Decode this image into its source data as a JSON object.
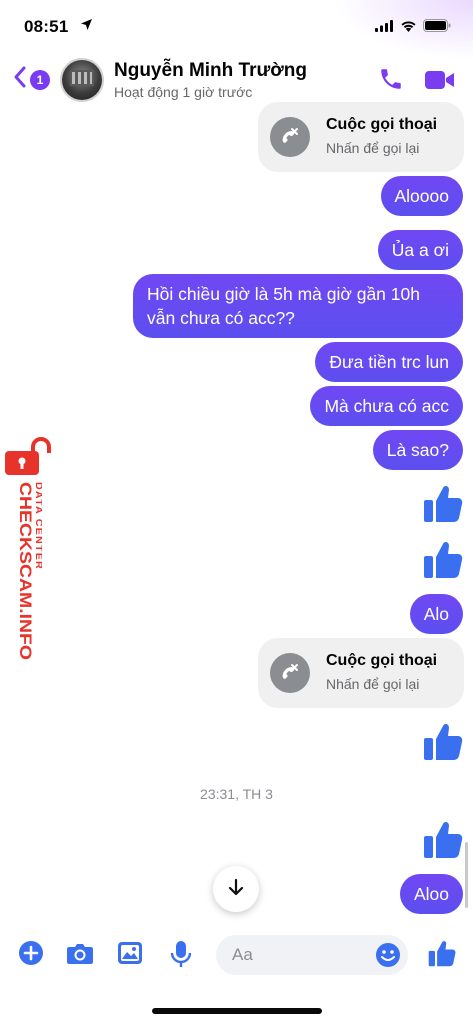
{
  "status_bar": {
    "time": "08:51"
  },
  "header": {
    "back_badge": "1",
    "contact_name": "Nguyễn Minh Trường",
    "contact_status": "Hoạt động 1 giờ trước"
  },
  "messages": {
    "call_1": {
      "title": "Cuộc gọi thoại",
      "subtitle": "Nhấn để gọi lại"
    },
    "m1": "Aloooo",
    "m2": "Ủa a ơi",
    "m3": "Hồi chiều giờ là 5h mà giờ gần 10h vẫn chưa có acc??",
    "m4": "Đưa tiền trc lun",
    "m5": "Mà chưa có acc",
    "m6": "Là sao?",
    "m7": "Alo",
    "call_2": {
      "title": "Cuộc gọi thoại",
      "subtitle": "Nhấn để gọi lại"
    },
    "timestamp": "23:31, TH 3",
    "m8": "Aloo"
  },
  "watermark": {
    "line1": "DATA CENTER",
    "line2": "CHECKSCAM.INFO"
  },
  "composer": {
    "placeholder": "Aa"
  },
  "colors": {
    "accent": "#7a3cf0",
    "bubble": "#6a4cf2",
    "like": "#3a6ff0",
    "watermark": "#e8332b"
  },
  "icons": [
    "location-arrow-icon",
    "signal-icon",
    "wifi-icon",
    "battery-icon",
    "back-chevron-icon",
    "phone-icon",
    "video-icon",
    "missed-call-icon",
    "thumbs-up-icon",
    "arrow-down-icon",
    "plus-icon",
    "camera-icon",
    "image-icon",
    "microphone-icon",
    "emoji-icon",
    "lock-icon"
  ]
}
